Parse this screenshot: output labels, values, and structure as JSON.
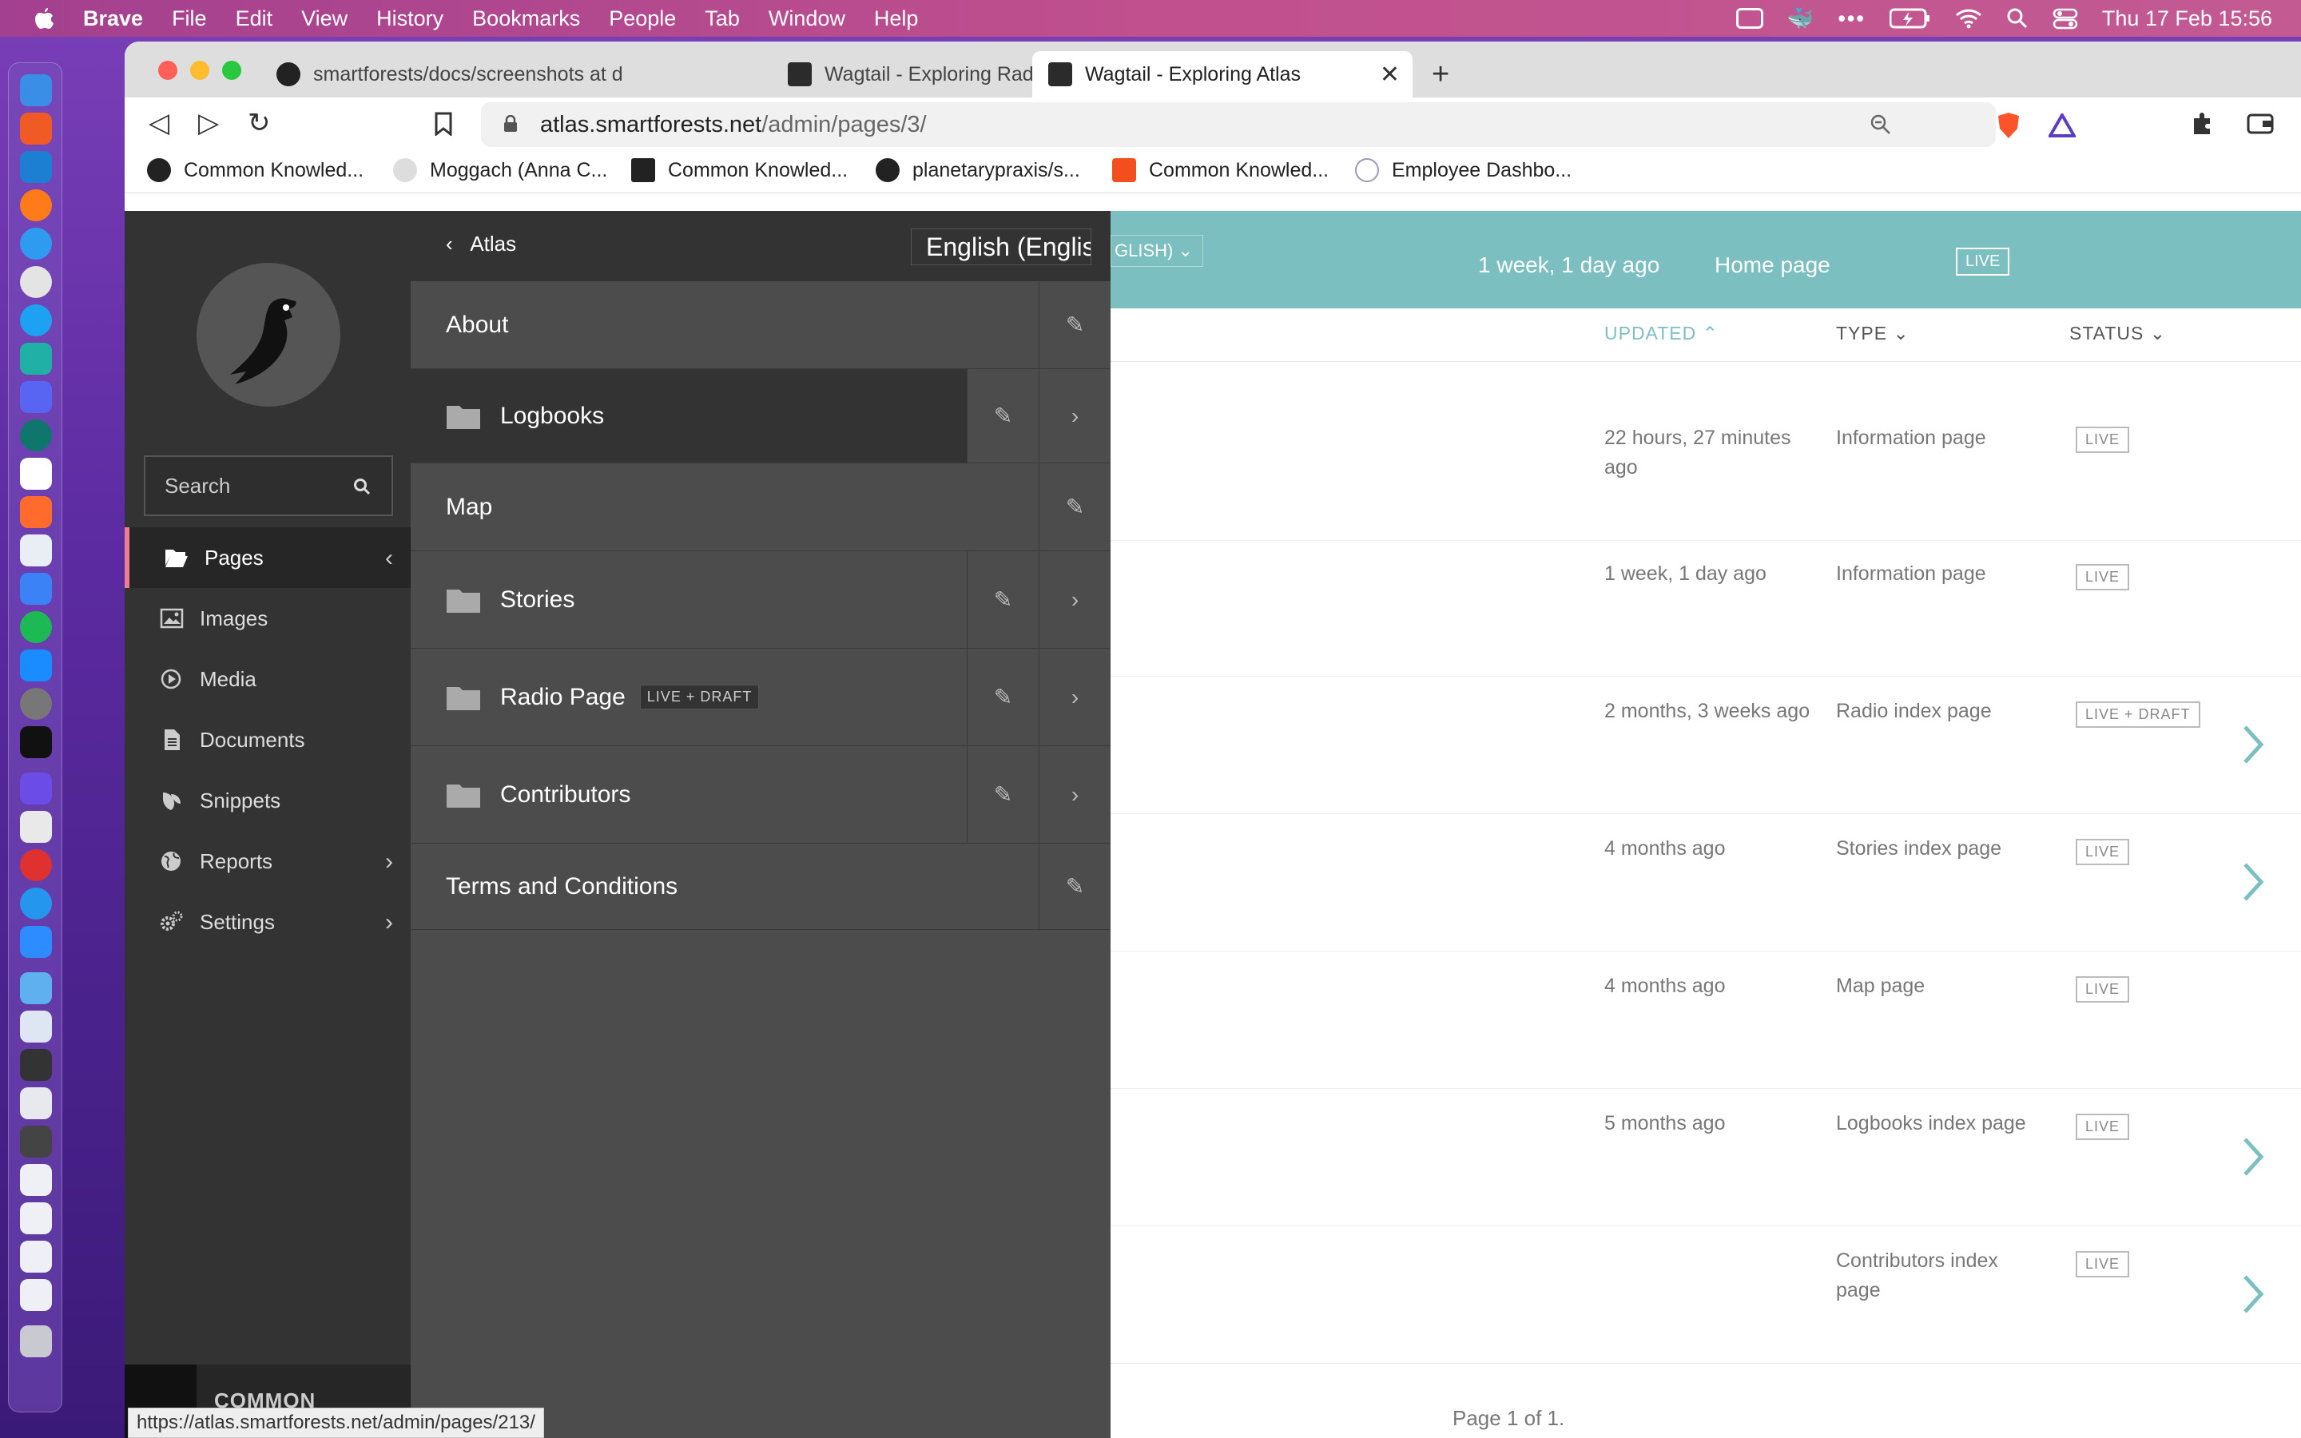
{
  "menubar": {
    "app": "Brave",
    "items": [
      "File",
      "Edit",
      "View",
      "History",
      "Bookmarks",
      "People",
      "Tab",
      "Window",
      "Help"
    ],
    "clock": "Thu 17 Feb  15:56"
  },
  "browser": {
    "tabs": [
      {
        "title": "smartforests/docs/screenshots at d"
      },
      {
        "title": "Wagtail - Exploring Radio Page"
      },
      {
        "title": "Wagtail - Exploring Atlas"
      }
    ],
    "url_host": "atlas.smartforests.net",
    "url_path": "/admin/pages/3/",
    "bookmarks": [
      "Common Knowled...",
      "Moggach (Anna C...",
      "Common Knowled...",
      "planetarypraxis/s...",
      "Common Knowled...",
      "Employee Dashbo..."
    ],
    "status_url": "https://atlas.smartforests.net/admin/pages/213/"
  },
  "sidebar": {
    "search_placeholder": "Search",
    "items": [
      {
        "label": "Pages"
      },
      {
        "label": "Images"
      },
      {
        "label": "Media"
      },
      {
        "label": "Documents"
      },
      {
        "label": "Snippets"
      },
      {
        "label": "Reports"
      },
      {
        "label": "Settings"
      }
    ],
    "account_label": "COMMON"
  },
  "explorer": {
    "back_label": "Atlas",
    "locale": "English (English)",
    "rows": [
      {
        "title": "About"
      },
      {
        "title": "Logbooks"
      },
      {
        "title": "Map"
      },
      {
        "title": "Stories"
      },
      {
        "title": "Radio Page",
        "badge": "LIVE + DRAFT"
      },
      {
        "title": "Contributors"
      },
      {
        "title": "Terms and Conditions"
      }
    ]
  },
  "listing": {
    "header": {
      "locale": "GLISH)",
      "updated": "1 week, 1 day ago",
      "type": "Home page",
      "status": "LIVE"
    },
    "columns": {
      "updated": "UPDATED",
      "type": "TYPE",
      "status": "STATUS"
    },
    "rows": [
      {
        "updated": "22 hours, 27 minutes ago",
        "type": "Information page",
        "status": "LIVE"
      },
      {
        "updated": "1 week, 1 day ago",
        "type": "Information page",
        "status": "LIVE"
      },
      {
        "updated": "2 months, 3 weeks ago",
        "type": "Radio index page",
        "status": "LIVE + DRAFT"
      },
      {
        "updated": "4 months ago",
        "type": "Stories index page",
        "status": "LIVE"
      },
      {
        "updated": "4 months ago",
        "type": "Map page",
        "status": "LIVE"
      },
      {
        "updated": "5 months ago",
        "type": "Logbooks index page",
        "status": "LIVE"
      },
      {
        "updated": "",
        "type": "Contributors index page",
        "status": "LIVE"
      }
    ],
    "pagination": "Page 1 of 1."
  }
}
